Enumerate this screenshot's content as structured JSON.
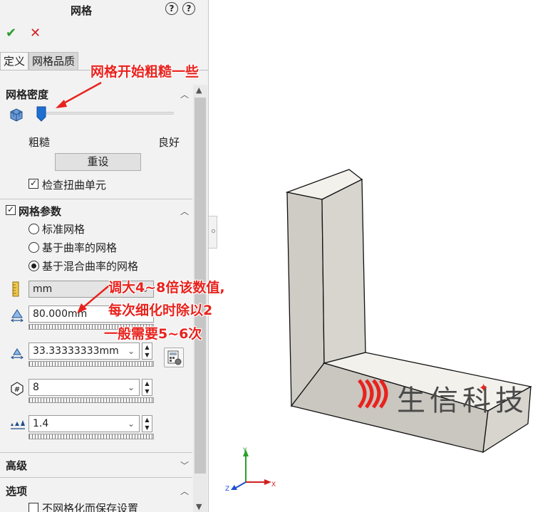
{
  "panel": {
    "title": "网格",
    "help_glyph": "?",
    "ok_glyph": "✔",
    "cancel_glyph": "✕",
    "tabs": [
      {
        "label": "定义",
        "active": true
      },
      {
        "label": "网格品质",
        "active": false
      }
    ],
    "mesh_density": {
      "title": "网格密度",
      "coarse_label": "粗糙",
      "fine_label": "良好",
      "slider_level": 0.0,
      "reset_label": "重设",
      "check_distorted_label": "检查扭曲单元",
      "check_distorted_checked": true
    },
    "mesh_params": {
      "title": "网格参数",
      "checked": true,
      "options": [
        {
          "label": "标准网格",
          "selected": false
        },
        {
          "label": "基于曲率的网格",
          "selected": false
        },
        {
          "label": "基于混合曲率的网格",
          "selected": true
        }
      ],
      "unit": "mm",
      "max_element_size": "80.000mm",
      "min_element_size": "33.33333333mm",
      "min_elements_in_circle": "8",
      "growth_ratio": "1.4"
    },
    "advanced_title": "高级",
    "options_title": "选项",
    "save_settings_label": "不网格化而保存设置",
    "save_settings_checked": false
  },
  "annotations": {
    "coarse_note": "网格开始粗糙一些",
    "size_note_line1": "调大4~8倍该数值,",
    "size_note_line2": "每次细化时除以2",
    "size_note_line3": "一般需要5~6次"
  },
  "watermark": {
    "text": "生信科技"
  },
  "triad": {
    "x_label": "X",
    "y_label": "Y",
    "z_label": "Z"
  },
  "icons": {
    "mesh_density_icon": "mesh-cube-icon",
    "unit_icon": "ruler-icon",
    "max_size_icon": "max-size-triangle-icon",
    "min_size_icon": "min-size-triangle-icon",
    "circle_elements_icon": "circle-hash-icon",
    "ratio_icon": "growth-ratio-icon",
    "calc_icon": "calculator-icon"
  },
  "colors": {
    "annotation": "#e8231e",
    "ok": "#2a9a2a",
    "cancel": "#d02020",
    "slider_thumb": "#1f6fd1"
  }
}
